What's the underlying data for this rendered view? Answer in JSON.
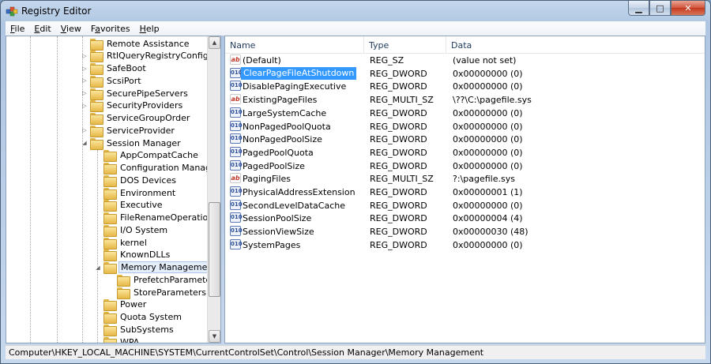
{
  "window": {
    "title": "Registry Editor"
  },
  "menu": [
    {
      "key": "F",
      "rest": "ile"
    },
    {
      "key": "E",
      "rest": "dit"
    },
    {
      "key": "V",
      "rest": "iew"
    },
    {
      "key": "",
      "pre": "F",
      "mid": "a",
      "rest": "vorites"
    },
    {
      "key": "H",
      "rest": "elp"
    }
  ],
  "tree": {
    "items": [
      {
        "label": "Remote Assistance",
        "level": 1,
        "expander": ""
      },
      {
        "label": "RtlQueryRegistryConfig",
        "level": 1,
        "expander": "▷"
      },
      {
        "label": "SafeBoot",
        "level": 1,
        "expander": "▷"
      },
      {
        "label": "ScsiPort",
        "level": 1,
        "expander": "▷"
      },
      {
        "label": "SecurePipeServers",
        "level": 1,
        "expander": "▷"
      },
      {
        "label": "SecurityProviders",
        "level": 1,
        "expander": "▷"
      },
      {
        "label": "ServiceGroupOrder",
        "level": 1,
        "expander": ""
      },
      {
        "label": "ServiceProvider",
        "level": 1,
        "expander": "▷"
      },
      {
        "label": "Session Manager",
        "level": 1,
        "expander": "◢"
      },
      {
        "label": "AppCompatCache",
        "level": 2,
        "expander": ""
      },
      {
        "label": "Configuration Manager",
        "level": 2,
        "expander": ""
      },
      {
        "label": "DOS Devices",
        "level": 2,
        "expander": ""
      },
      {
        "label": "Environment",
        "level": 2,
        "expander": ""
      },
      {
        "label": "Executive",
        "level": 2,
        "expander": ""
      },
      {
        "label": "FileRenameOperations",
        "level": 2,
        "expander": ""
      },
      {
        "label": "I/O System",
        "level": 2,
        "expander": ""
      },
      {
        "label": "kernel",
        "level": 2,
        "expander": ""
      },
      {
        "label": "KnownDLLs",
        "level": 2,
        "expander": ""
      },
      {
        "label": "Memory Management",
        "level": 2,
        "expander": "◢",
        "selected": true
      },
      {
        "label": "PrefetchParameters",
        "level": 3,
        "expander": ""
      },
      {
        "label": "StoreParameters",
        "level": 3,
        "expander": ""
      },
      {
        "label": "Power",
        "level": 2,
        "expander": ""
      },
      {
        "label": "Quota System",
        "level": 2,
        "expander": ""
      },
      {
        "label": "SubSystems",
        "level": 2,
        "expander": ""
      },
      {
        "label": "WPA",
        "level": 2,
        "expander": ""
      }
    ]
  },
  "list": {
    "columns": [
      "Name",
      "Type",
      "Data"
    ],
    "rows": [
      {
        "icon": "string-value-icon",
        "name": "(Default)",
        "type": "REG_SZ",
        "data": "(value not set)"
      },
      {
        "icon": "dword-value-icon",
        "name": "ClearPageFileAtShutdown",
        "type": "REG_DWORD",
        "data": "0x00000000 (0)",
        "selected": true
      },
      {
        "icon": "dword-value-icon",
        "name": "DisablePagingExecutive",
        "type": "REG_DWORD",
        "data": "0x00000000 (0)"
      },
      {
        "icon": "string-value-icon",
        "name": "ExistingPageFiles",
        "type": "REG_MULTI_SZ",
        "data": "\\??\\C:\\pagefile.sys"
      },
      {
        "icon": "dword-value-icon",
        "name": "LargeSystemCache",
        "type": "REG_DWORD",
        "data": "0x00000000 (0)"
      },
      {
        "icon": "dword-value-icon",
        "name": "NonPagedPoolQuota",
        "type": "REG_DWORD",
        "data": "0x00000000 (0)"
      },
      {
        "icon": "dword-value-icon",
        "name": "NonPagedPoolSize",
        "type": "REG_DWORD",
        "data": "0x00000000 (0)"
      },
      {
        "icon": "dword-value-icon",
        "name": "PagedPoolQuota",
        "type": "REG_DWORD",
        "data": "0x00000000 (0)"
      },
      {
        "icon": "dword-value-icon",
        "name": "PagedPoolSize",
        "type": "REG_DWORD",
        "data": "0x00000000 (0)"
      },
      {
        "icon": "string-value-icon",
        "name": "PagingFiles",
        "type": "REG_MULTI_SZ",
        "data": "?:\\pagefile.sys"
      },
      {
        "icon": "dword-value-icon",
        "name": "PhysicalAddressExtension",
        "type": "REG_DWORD",
        "data": "0x00000001 (1)"
      },
      {
        "icon": "dword-value-icon",
        "name": "SecondLevelDataCache",
        "type": "REG_DWORD",
        "data": "0x00000000 (0)"
      },
      {
        "icon": "dword-value-icon",
        "name": "SessionPoolSize",
        "type": "REG_DWORD",
        "data": "0x00000004 (4)"
      },
      {
        "icon": "dword-value-icon",
        "name": "SessionViewSize",
        "type": "REG_DWORD",
        "data": "0x00000030 (48)"
      },
      {
        "icon": "dword-value-icon",
        "name": "SystemPages",
        "type": "REG_DWORD",
        "data": "0x00000000 (0)"
      }
    ]
  },
  "status": {
    "path": "Computer\\HKEY_LOCAL_MACHINE\\SYSTEM\\CurrentControlSet\\Control\\Session Manager\\Memory Management"
  }
}
